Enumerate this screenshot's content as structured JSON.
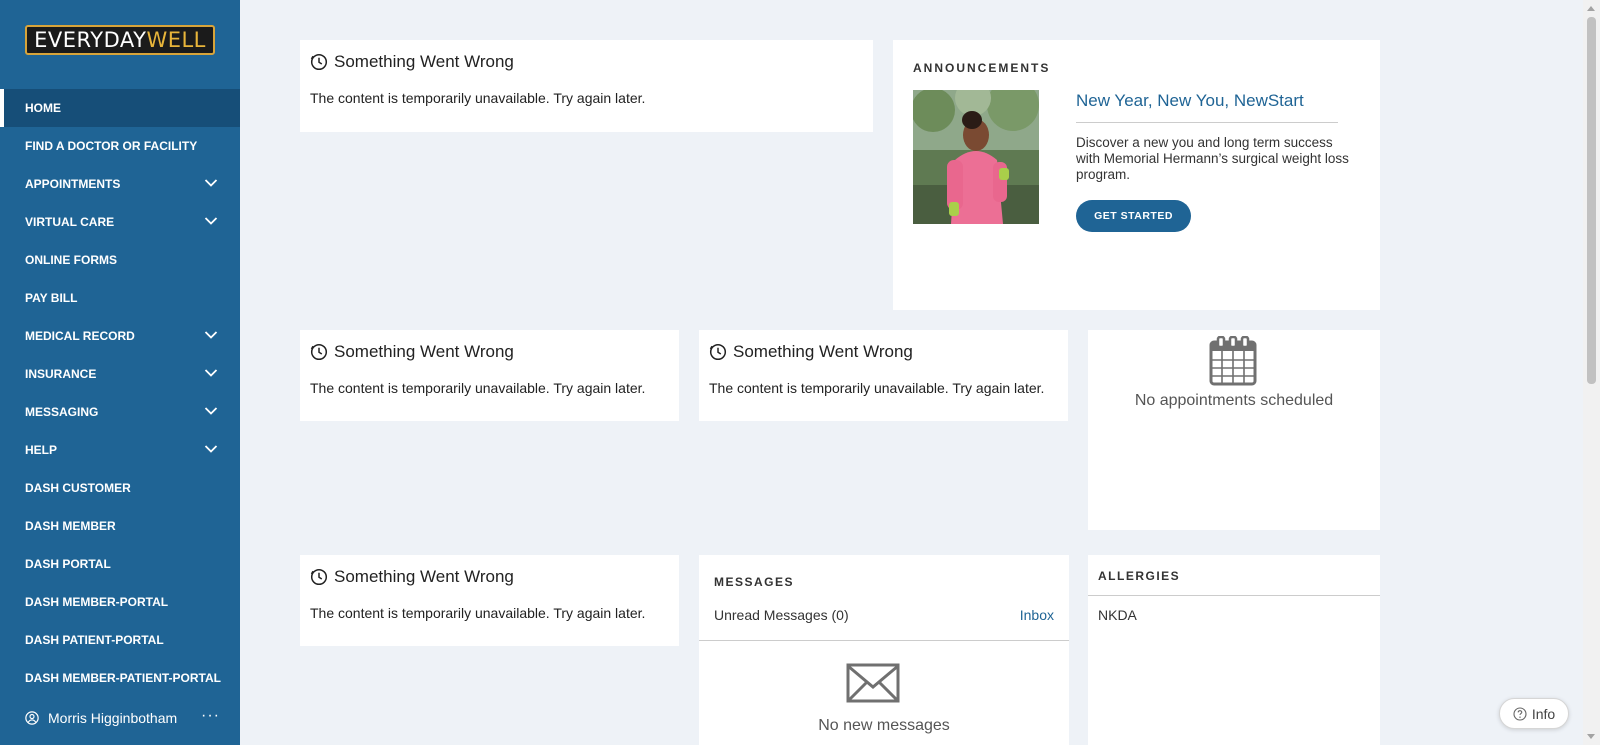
{
  "brand": {
    "logo_part1": "EVERYDAY",
    "logo_part2": "WELL"
  },
  "sidebar": {
    "items": [
      {
        "label": "HOME",
        "active": true,
        "expandable": false
      },
      {
        "label": "FIND A DOCTOR OR FACILITY",
        "expandable": false
      },
      {
        "label": "APPOINTMENTS",
        "expandable": true
      },
      {
        "label": "VIRTUAL CARE",
        "expandable": true
      },
      {
        "label": "ONLINE FORMS",
        "expandable": false
      },
      {
        "label": "PAY BILL",
        "expandable": false
      },
      {
        "label": "MEDICAL RECORD",
        "expandable": true
      },
      {
        "label": "INSURANCE",
        "expandable": true
      },
      {
        "label": "MESSAGING",
        "expandable": true
      },
      {
        "label": "HELP",
        "expandable": true
      },
      {
        "label": "DASH CUSTOMER",
        "expandable": false
      },
      {
        "label": "DASH MEMBER",
        "expandable": false
      },
      {
        "label": "DASH PORTAL",
        "expandable": false
      },
      {
        "label": "DASH MEMBER-PORTAL",
        "expandable": false
      },
      {
        "label": "DASH PATIENT-PORTAL",
        "expandable": false
      },
      {
        "label": "DASH MEMBER-PATIENT-PORTAL",
        "expandable": false
      }
    ],
    "user": {
      "name": "Morris Higginbotham",
      "more_label": "···"
    }
  },
  "error_cards": [
    {
      "title": "Something Went Wrong",
      "text": "The content is temporarily unavailable. Try again later."
    },
    {
      "title": "Something Went Wrong",
      "text": "The content is temporarily unavailable. Try again later."
    },
    {
      "title": "Something Went Wrong",
      "text": "The content is temporarily unavailable. Try again later."
    },
    {
      "title": "Something Went Wrong",
      "text": "The content is temporarily unavailable. Try again later."
    }
  ],
  "announcements": {
    "heading": "ANNOUNCEMENTS",
    "title": "New Year, New You, NewStart",
    "description": "Discover a new you and long term success with Memorial Hermann’s surgical weight loss program.",
    "button_label": "GET STARTED"
  },
  "appointments": {
    "empty_text": "No appointments scheduled"
  },
  "messages": {
    "heading": "MESSAGES",
    "unread_label": "Unread Messages (0)",
    "inbox_label": "Inbox",
    "empty_text": "No new messages"
  },
  "allergies": {
    "heading": "ALLERGIES",
    "value": "NKDA"
  },
  "info_button": {
    "label": "Info"
  },
  "colors": {
    "sidebar": "#1f6495",
    "accent": "#1f6495",
    "page_bg": "#eef2f7",
    "logo_gold": "#e8b53a"
  }
}
